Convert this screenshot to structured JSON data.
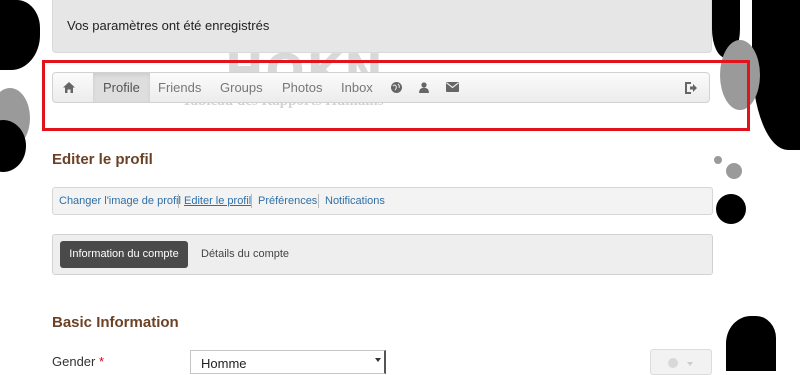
{
  "alert": {
    "message": "Vos paramètres ont été enregistrés"
  },
  "background": {
    "logo_text": "HOKN",
    "subtitle": "Tableau des Rapports Humains"
  },
  "navbar": {
    "home_icon": "home-icon",
    "items": [
      {
        "label": "Profile",
        "active": true
      },
      {
        "label": "Friends",
        "active": false
      },
      {
        "label": "Groups",
        "active": false
      },
      {
        "label": "Photos",
        "active": false
      },
      {
        "label": "Inbox",
        "active": false
      }
    ],
    "icons": [
      "globe-icon",
      "user-icon",
      "envelope-icon"
    ],
    "logout_icon": "logout-icon"
  },
  "page": {
    "title": "Editer le profil"
  },
  "subnav": {
    "links": [
      {
        "label": "Changer l'image de profil",
        "active": false
      },
      {
        "label": "Editer le profil",
        "active": true
      },
      {
        "label": "Préférences",
        "active": false
      },
      {
        "label": "Notifications",
        "active": false
      }
    ]
  },
  "tabs": {
    "active": "Information du compte",
    "other": "Détails du compte"
  },
  "basic_info": {
    "title": "Basic Information",
    "gender_label": "Gender",
    "required_mark": "*",
    "gender_value": "Homme"
  },
  "colors": {
    "highlight": "#e1131d",
    "heading": "#6b4225",
    "link": "#2f6fa7"
  }
}
